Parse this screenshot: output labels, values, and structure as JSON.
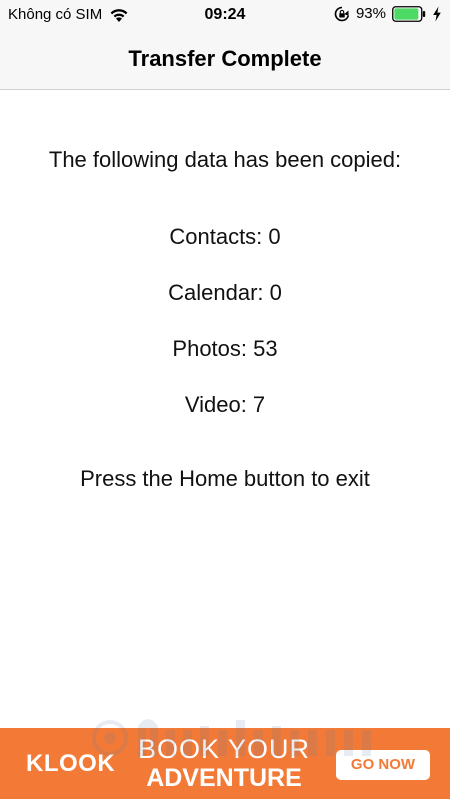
{
  "status_bar": {
    "carrier": "Không có SIM",
    "time": "09:24",
    "battery_percent": "93%",
    "battery_level": 93,
    "battery_color": "#4cd964",
    "icons": [
      "wifi-icon",
      "lock-rotation-icon",
      "battery-icon",
      "charge-icon"
    ]
  },
  "nav": {
    "title": "Transfer Complete"
  },
  "content": {
    "intro": "The following data has been copied:",
    "contacts": "Contacts: 0",
    "calendar": "Calendar: 0",
    "photos": "Photos: 53",
    "video": "Video: 7",
    "exit_hint": "Press the Home button to exit"
  },
  "ad": {
    "brand": "KLOOK",
    "headline_1": "BOOK YOUR",
    "headline_2": "ADVENTURE",
    "cta": "GO NOW",
    "background": "#f27a36"
  }
}
